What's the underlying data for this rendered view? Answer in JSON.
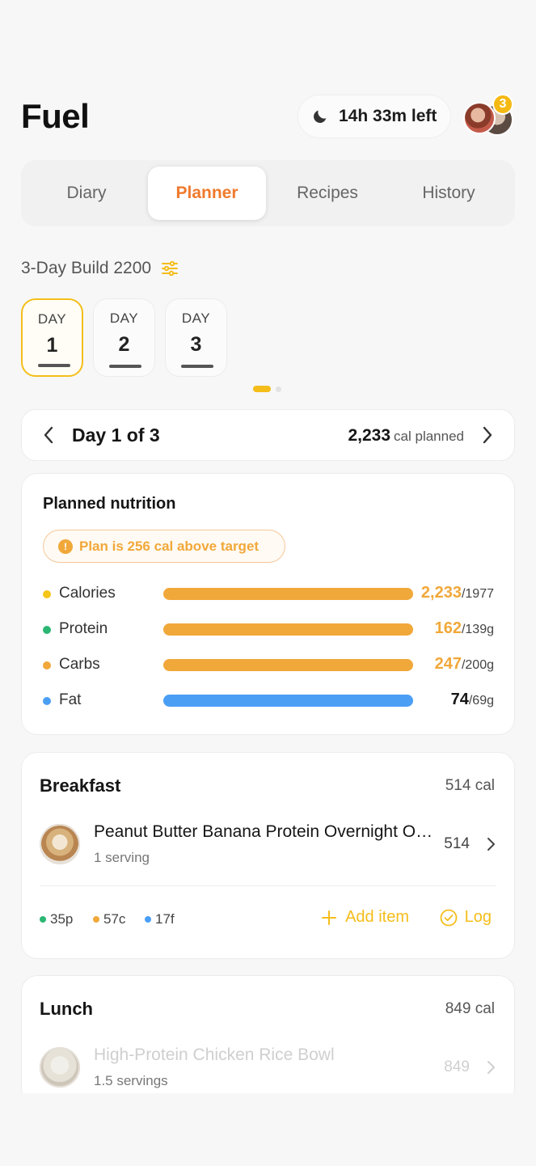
{
  "header": {
    "app_title": "Fuel",
    "timer_text": "14h 33m left",
    "notification_count": "3"
  },
  "tabs": [
    {
      "label": "Diary",
      "active": false
    },
    {
      "label": "Planner",
      "active": true
    },
    {
      "label": "Recipes",
      "active": false
    },
    {
      "label": "History",
      "active": false
    }
  ],
  "plan": {
    "name": "3-Day Build 2200",
    "days": [
      {
        "label": "DAY",
        "number": "1",
        "active": true
      },
      {
        "label": "DAY",
        "number": "2",
        "active": false
      },
      {
        "label": "DAY",
        "number": "3",
        "active": false
      }
    ]
  },
  "day_nav": {
    "title": "Day 1 of 3",
    "planned_value": "2,233",
    "planned_unit": "cal planned"
  },
  "nutrition": {
    "title": "Planned nutrition",
    "warning": "Plan is 256 cal above target",
    "macros": [
      {
        "name": "Calories",
        "value": "2,233",
        "target": "/1977",
        "dot_color": "#f5c518",
        "bar_color": "#f1a83a",
        "value_color": "#f1a83a",
        "fill": 1.0
      },
      {
        "name": "Protein",
        "value": "162",
        "target": "/139g",
        "dot_color": "#2bb673",
        "bar_color": "#f1a83a",
        "value_color": "#f1a83a",
        "fill": 1.0
      },
      {
        "name": "Carbs",
        "value": "247",
        "target": "/200g",
        "dot_color": "#f1a83a",
        "bar_color": "#f1a83a",
        "value_color": "#f1a83a",
        "fill": 1.0
      },
      {
        "name": "Fat",
        "value": "74",
        "target": "/69g",
        "dot_color": "#4a9ff5",
        "bar_color": "#4a9ff5",
        "value_color": "#151515",
        "fill": 1.0
      }
    ]
  },
  "breakfast": {
    "title": "Breakfast",
    "cal": "514 cal",
    "item": {
      "name": "Peanut Butter Banana Protein Overnight Oats",
      "serving": "1 serving",
      "cal": "514"
    },
    "macros": {
      "protein": "35p",
      "carbs": "57c",
      "fat": "17f"
    },
    "add_label": "Add item",
    "log_label": "Log"
  },
  "lunch": {
    "title": "Lunch",
    "cal": "849 cal",
    "item": {
      "name": "High-Protein Chicken Rice Bowl",
      "serving": "1.5 servings",
      "cal": "849"
    }
  },
  "colors": {
    "accent": "#f5bd1a",
    "orange": "#ef7a2c"
  }
}
